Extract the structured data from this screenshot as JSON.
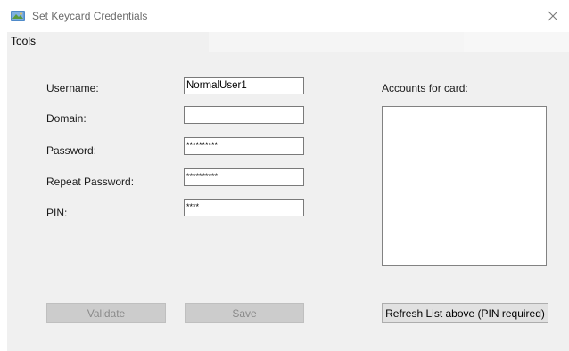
{
  "window": {
    "title": "Set Keycard Credentials",
    "icon": "keycard-app-icon",
    "close_icon": "close-icon"
  },
  "menu": {
    "items": [
      {
        "label": "Tools"
      }
    ]
  },
  "form": {
    "username_label": "Username:",
    "username_value": "NormalUser1",
    "domain_label": "Domain:",
    "domain_value": "",
    "password_label": "Password:",
    "password_value": "**********",
    "repeat_password_label": "Repeat Password:",
    "repeat_password_value": "**********",
    "pin_label": "PIN:",
    "pin_value": "****"
  },
  "accounts": {
    "label": "Accounts for card:",
    "items": []
  },
  "buttons": {
    "validate_label": "Validate",
    "save_label": "Save",
    "refresh_label": "Refresh List above (PIN required)"
  },
  "colors": {
    "dialog_bg": "#f0f0f0",
    "disabled_button_bg": "#cccccc",
    "disabled_text": "#8a8a8a"
  }
}
